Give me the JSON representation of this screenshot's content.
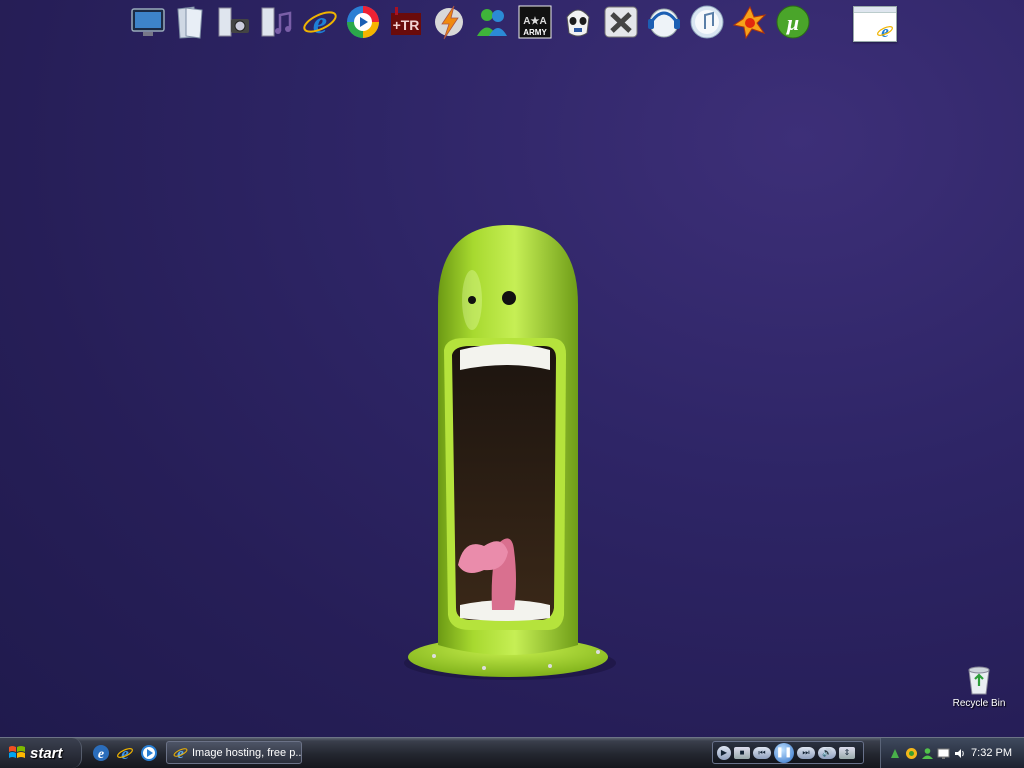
{
  "dock": {
    "icons": [
      "monitor-icon",
      "documents-icon",
      "camera-icon",
      "music-icon",
      "internet-explorer-icon",
      "media-player-icon",
      "video-icon",
      "lightning-icon",
      "messenger-icon",
      "america-army-icon",
      "stormtrooper-icon",
      "x-app-icon",
      "headset-icon",
      "itunes-icon",
      "winamp-icon",
      "utorrent-icon"
    ],
    "army_text": "ARMY"
  },
  "desktop": {
    "recycle_bin_label": "Recycle Bin"
  },
  "taskbar": {
    "start_label": "start",
    "quick_launch": [
      "ie-icon",
      "ie-icon",
      "media-player-icon"
    ],
    "task_button_label": "Image hosting, free p...",
    "clock": "7:32 PM",
    "tray_icons": [
      "network-icon",
      "messenger-status-icon",
      "user-icon",
      "display-icon",
      "volume-icon"
    ]
  },
  "colors": {
    "wallpaper": "#2e2566",
    "character_green": "#9bd12a"
  }
}
